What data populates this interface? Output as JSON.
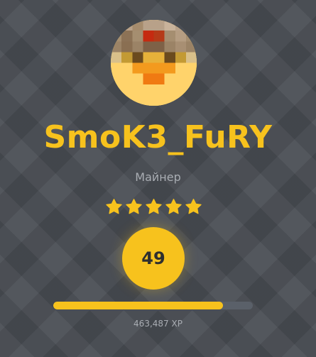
{
  "profile": {
    "username": "SmoK3_FuRY",
    "rank": "Майнер",
    "stars": 5,
    "level": "49",
    "xp_label": "463,487 XP",
    "xp_progress": 0.85
  },
  "colors": {
    "accent": "#f7c21d",
    "muted_text": "#a9adb3",
    "background": "#474b51",
    "track": "#5a6069"
  },
  "icons": {
    "star": "star-icon",
    "avatar": "pixel-skin-avatar"
  }
}
